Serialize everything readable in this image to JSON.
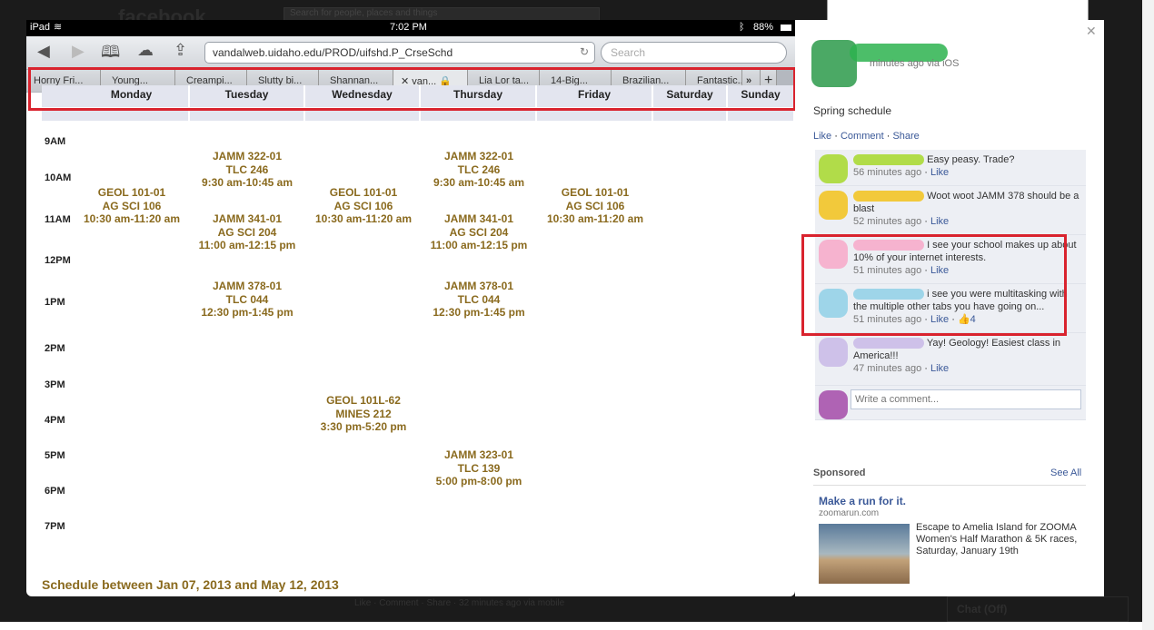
{
  "facebook": {
    "logo": "facebook",
    "search_placeholder": "Search for people, places and things"
  },
  "status_bar": {
    "device": "iPad",
    "time": "7:02 PM",
    "battery": "88%"
  },
  "browser": {
    "url": "vandalweb.uidaho.edu/PROD/uifshd.P_CrseSchd",
    "search_placeholder": "Search",
    "tabs": [
      "Horny Fri...",
      "Young...",
      "Creampi...",
      "Slutty bi...",
      "Shannan...",
      "van...",
      "Lia Lor ta...",
      "14-Big...",
      "Brazilian...",
      "Fantastic..."
    ],
    "more": "»",
    "new_tab": "+"
  },
  "schedule": {
    "days": [
      "Monday",
      "Tuesday",
      "Wednesday",
      "Thursday",
      "Friday",
      "Saturday",
      "Sunday"
    ],
    "times": [
      "9AM",
      "10AM",
      "11AM",
      "12PM",
      "1PM",
      "2PM",
      "3PM",
      "4PM",
      "5PM",
      "6PM",
      "7PM"
    ],
    "events": [
      {
        "day": "Monday",
        "lines": [
          "GEOL 101-01",
          "AG SCI 106",
          "10:30 am-11:20 am"
        ]
      },
      {
        "day": "Tuesday",
        "lines": [
          "JAMM 322-01",
          "TLC 246",
          "9:30 am-10:45 am"
        ]
      },
      {
        "day": "Tuesday",
        "lines": [
          "JAMM 341-01",
          "AG SCI 204",
          "11:00 am-12:15 pm"
        ]
      },
      {
        "day": "Tuesday",
        "lines": [
          "JAMM 378-01",
          "TLC 044",
          "12:30 pm-1:45 pm"
        ]
      },
      {
        "day": "Wednesday",
        "lines": [
          "GEOL 101-01",
          "AG SCI 106",
          "10:30 am-11:20 am"
        ]
      },
      {
        "day": "Wednesday",
        "lines": [
          "GEOL 101L-62",
          "MINES 212",
          "3:30 pm-5:20 pm"
        ]
      },
      {
        "day": "Thursday",
        "lines": [
          "JAMM 322-01",
          "TLC 246",
          "9:30 am-10:45 am"
        ]
      },
      {
        "day": "Thursday",
        "lines": [
          "JAMM 341-01",
          "AG SCI 204",
          "11:00 am-12:15 pm"
        ]
      },
      {
        "day": "Thursday",
        "lines": [
          "JAMM 378-01",
          "TLC 044",
          "12:30 pm-1:45 pm"
        ]
      },
      {
        "day": "Thursday",
        "lines": [
          "JAMM 323-01",
          "TLC 139",
          "5:00 pm-8:00 pm"
        ]
      },
      {
        "day": "Friday",
        "lines": [
          "GEOL 101-01",
          "AG SCI 106",
          "10:30 am-11:20 am"
        ]
      }
    ],
    "footer": "Schedule between Jan 07, 2013 and May 12, 2013"
  },
  "post": {
    "meta": "minutes ago via iOS",
    "caption": "Spring schedule",
    "actions": [
      "Like",
      "Comment",
      "Share"
    ],
    "comments": [
      {
        "text": "Easy peasy. Trade?",
        "time": "56 minutes ago",
        "like": "Like",
        "color": "#a6d82a"
      },
      {
        "text": "Woot woot JAMM 378 should be a blast",
        "time": "52 minutes ago",
        "like": "Like",
        "color": "#f2c21a"
      },
      {
        "text": "I see your school makes up about 10% of your internet interests.",
        "time": "51 minutes ago",
        "like": "Like",
        "color": "#f7a8c8"
      },
      {
        "text": "i see you were multitasking with the multiple other tabs you have going on...",
        "time": "51 minutes ago",
        "like": "Like",
        "likes": "4",
        "color": "#8fd0e6"
      },
      {
        "text": "Yay! Geology! Easiest class in America!!!",
        "time": "47 minutes ago",
        "like": "Like",
        "color": "#c8b8e6"
      }
    ],
    "comment_placeholder": "Write a comment..."
  },
  "sponsored": {
    "label": "Sponsored",
    "see_all": "See All",
    "ad_title": "Make a run for it.",
    "ad_domain": "zoomarun.com",
    "ad_text": "Escape to Amelia Island for ZOOMA Women's Half Marathon & 5K races, Saturday, January 19th"
  },
  "chat": {
    "label": "Chat (Off)"
  },
  "below": {
    "text": "Like · Comment · Share · 32 minutes ago via mobile"
  }
}
